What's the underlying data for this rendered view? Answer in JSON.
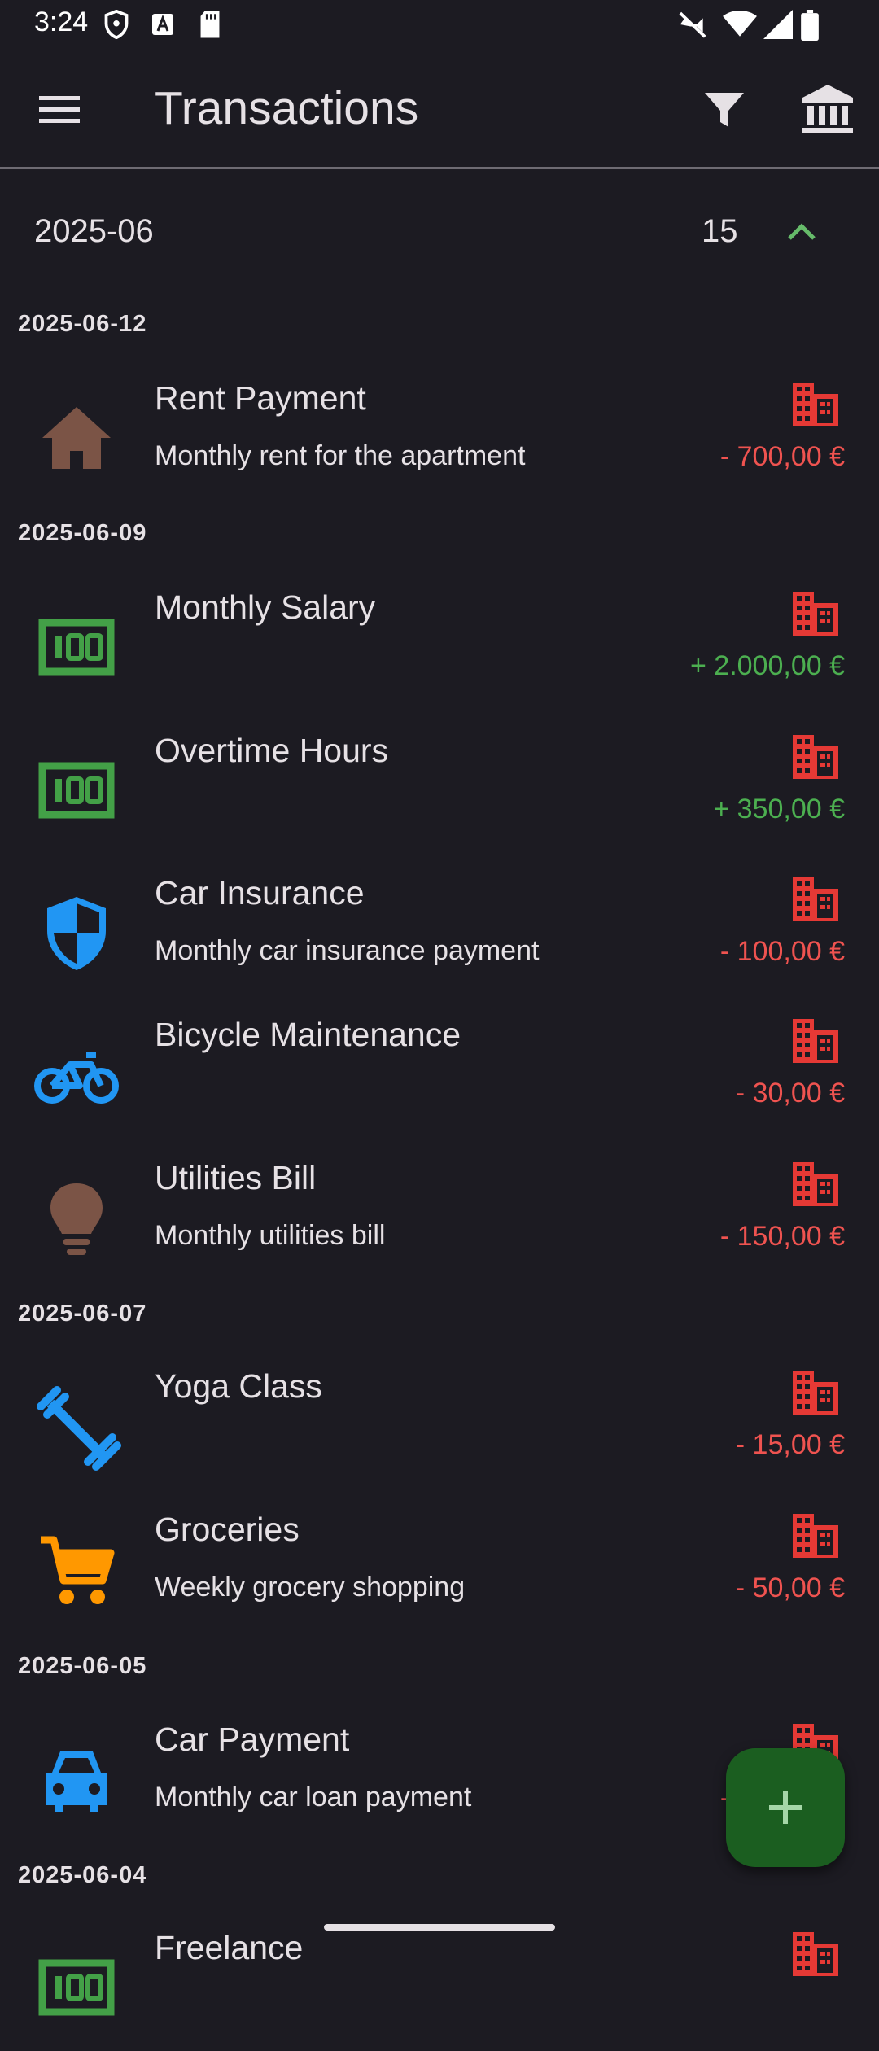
{
  "status_bar": {
    "time": "3:24",
    "icons": [
      "shield-icon",
      "font-a-icon",
      "sd-card-icon",
      "vibrate-off-icon",
      "wifi-icon",
      "signal-icon",
      "battery-icon"
    ]
  },
  "app_bar": {
    "title": "Transactions",
    "icons": [
      "menu-icon",
      "filter-icon",
      "bank-icon"
    ]
  },
  "month": {
    "label": "2025-06",
    "count": "15"
  },
  "dates": [
    "2025-06-12",
    "2025-06-09",
    "2025-06-07",
    "2025-06-05",
    "2025-06-04"
  ],
  "transactions": [
    {
      "title": "Rent Payment",
      "description": "Monthly rent for the apartment",
      "amount": "- 700,00 €",
      "icon": "house-icon",
      "icon_color": "#7b5446",
      "type": "expense"
    },
    {
      "title": "Monthly Salary",
      "description": "",
      "amount": "+ 2.000,00 €",
      "icon": "money-icon",
      "icon_color": "#43a047",
      "type": "income"
    },
    {
      "title": "Overtime Hours",
      "description": "",
      "amount": "+ 350,00 €",
      "icon": "money-icon",
      "icon_color": "#43a047",
      "type": "income"
    },
    {
      "title": "Car Insurance",
      "description": "Monthly car insurance payment",
      "amount": "- 100,00 €",
      "icon": "shield-icon",
      "icon_color": "#2196f3",
      "type": "expense"
    },
    {
      "title": "Bicycle Maintenance",
      "description": "",
      "amount": "- 30,00 €",
      "icon": "bicycle-icon",
      "icon_color": "#2196f3",
      "type": "expense"
    },
    {
      "title": "Utilities Bill",
      "description": "Monthly utilities bill",
      "amount": "- 150,00 €",
      "icon": "lightbulb-icon",
      "icon_color": "#7b5446",
      "type": "expense"
    },
    {
      "title": "Yoga Class",
      "description": "",
      "amount": "- 15,00 €",
      "icon": "fitness-icon",
      "icon_color": "#2196f3",
      "type": "expense"
    },
    {
      "title": "Groceries",
      "description": "Weekly grocery shopping",
      "amount": "- 50,00 €",
      "icon": "cart-icon",
      "icon_color": "#ff9800",
      "type": "expense"
    },
    {
      "title": "Car Payment",
      "description": "Monthly car loan payment",
      "amount": "- 300,00 €",
      "icon": "car-icon",
      "icon_color": "#2196f3",
      "type": "expense"
    },
    {
      "title": "Freelance",
      "description": "",
      "amount": "",
      "icon": "money-icon",
      "icon_color": "#43a047",
      "type": "income"
    }
  ],
  "colors": {
    "background": "#1c1b22",
    "expense": "#ef5350",
    "income": "#4caf50",
    "account_icon": "#e53935",
    "fab": "#1b5e20",
    "fab_icon": "#a5d6a7"
  },
  "fab": {
    "icon": "plus-icon"
  }
}
